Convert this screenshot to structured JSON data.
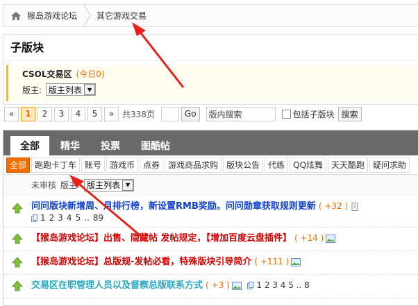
{
  "breadcrumb": {
    "home": "猴岛游戏论坛",
    "current": "其它游戏交易"
  },
  "subforum": {
    "title": "子版块",
    "name": "CSOL交易区",
    "today": "(今日0)",
    "mod_label": "版主:",
    "mod_select": "版主列表"
  },
  "pager": {
    "prev": "«",
    "pages": [
      "1",
      "2",
      "3",
      "4",
      "5"
    ],
    "next": "»",
    "total": "共338页",
    "go": "Go",
    "search_placeholder": "版内搜索",
    "include_sub": "包括子版块",
    "search": "搜索"
  },
  "tabs": [
    "全部",
    "精华",
    "投票",
    "图酷帖"
  ],
  "types": [
    "全部",
    "跑跑卡丁车",
    "账号",
    "游戏币",
    "点券",
    "游戏商品求购",
    "版块公告",
    "代练",
    "QQ炫舞",
    "天天酷跑",
    "疑问求助"
  ],
  "filter": {
    "unreviewed": "未审核",
    "mod_label": "版主:",
    "mod_select": "版主列表"
  },
  "threads": [
    {
      "title": "问问版块新增周、月排行榜，新设置RMB奖励。问问勋章获取规则更新",
      "count": "( +32 )",
      "pages": [
        "1",
        "2",
        "3",
        "4",
        "5",
        "..",
        "89"
      ]
    },
    {
      "title": "【猴岛游戏论坛】出售、隐藏帖 发帖规定，【增加百度云盘插件】",
      "count": "( +14 )"
    },
    {
      "title": "【猴岛游戏论坛】总版规-发帖必看，特殊版块引导简介",
      "count": "( +111 )"
    },
    {
      "title": "交易区在职管理人员以及督察总版联系方式",
      "count": "( +3 )",
      "pages": [
        "1",
        "2",
        "3",
        "4",
        "5",
        "..",
        "8"
      ]
    }
  ],
  "colors": {
    "accent": "#f26c00",
    "arrow": "#e8201a",
    "blue_title": "#0d3fcf",
    "red_title": "#d40000",
    "cyan_title": "#27a7c2"
  }
}
